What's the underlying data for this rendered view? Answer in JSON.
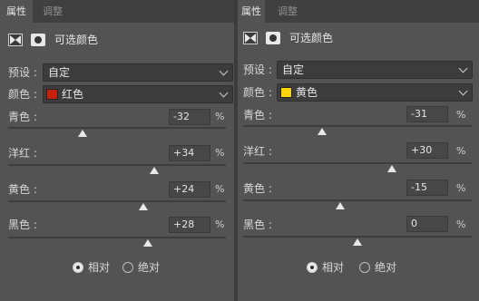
{
  "left": {
    "tabs": [
      {
        "label": "属性"
      },
      {
        "label": "调整"
      }
    ],
    "header_title": "可选颜色",
    "preset": {
      "label": "预设 :",
      "value": "自定"
    },
    "colors": {
      "label": "颜色 :",
      "value": "红色",
      "swatch": "#c8200c"
    },
    "sliders": [
      {
        "label": "青色 :",
        "value": "-32",
        "unit": "%",
        "level": -0.32
      },
      {
        "label": "洋红 :",
        "value": "+34",
        "unit": "%",
        "level": 0.34
      },
      {
        "label": "黄色 :",
        "value": "+24",
        "unit": "%",
        "level": 0.24
      },
      {
        "label": "黑色 :",
        "value": "+28",
        "unit": "%",
        "level": 0.28
      }
    ],
    "radio": {
      "relative": "相对",
      "absolute": "绝对",
      "selected": "relative"
    }
  },
  "right": {
    "tabs": [
      {
        "label": "属性"
      },
      {
        "label": "调整"
      }
    ],
    "header_title": "可选颜色",
    "preset": {
      "label": "预设 :",
      "value": "自定"
    },
    "colors": {
      "label": "颜色 :",
      "value": "黄色",
      "swatch": "#ffd400"
    },
    "sliders": [
      {
        "label": "青色 :",
        "value": "-31",
        "unit": "%",
        "level": -0.31
      },
      {
        "label": "洋红 :",
        "value": "+30",
        "unit": "%",
        "level": 0.3
      },
      {
        "label": "黄色 :",
        "value": "-15",
        "unit": "%",
        "level": -0.15
      },
      {
        "label": "黑色 :",
        "value": "0",
        "unit": "%",
        "level": 0
      }
    ],
    "radio": {
      "relative": "相对",
      "absolute": "绝对",
      "selected": "relative"
    }
  }
}
